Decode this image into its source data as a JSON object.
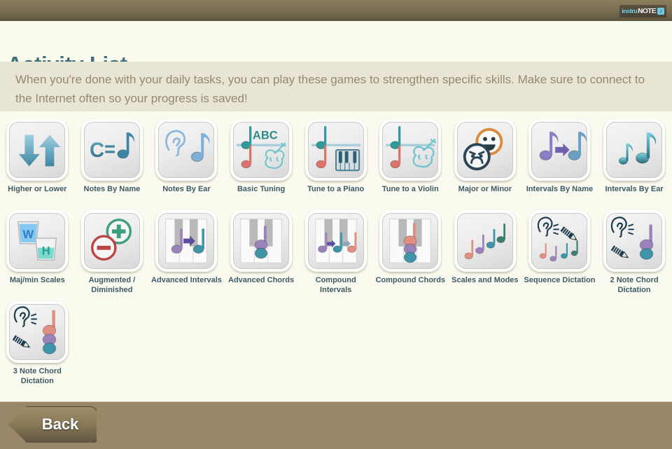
{
  "app": {
    "logo_part1": "instru",
    "logo_part2": "NOTE",
    "logo_badge": "♪"
  },
  "header": {
    "title": "Activity List",
    "description": "When you're done with your daily tasks, you can play these games to strengthen specific skills.  Make sure to connect to the Internet often so your progress is saved!"
  },
  "colors": {
    "topbar": "#7d7053",
    "page_background": "#fbfaee",
    "description_background": "#e8e5d5",
    "title_text": "#3f7078",
    "description_text": "#938a6e",
    "label_text": "#3d5a67",
    "bottombar": "#998767",
    "back_button": "#8a7a58"
  },
  "activities": [
    {
      "label": "Higher or Lower",
      "icon": "up-down-arrows-icon"
    },
    {
      "label": "Notes By Name",
      "icon": "c-equals-note-icon"
    },
    {
      "label": "Notes By Ear",
      "icon": "ear-note-icon"
    },
    {
      "label": "Basic Tuning",
      "icon": "abc-violin-staff-icon"
    },
    {
      "label": "Tune to a Piano",
      "icon": "piano-staff-icon"
    },
    {
      "label": "Tune to a Violin",
      "icon": "violin-staff-icon"
    },
    {
      "label": "Major or Minor",
      "icon": "happy-sad-faces-icon"
    },
    {
      "label": "Intervals By Name",
      "icon": "note-arrow-note-icon"
    },
    {
      "label": "Intervals By Ear",
      "icon": "two-notes-icon"
    },
    {
      "label": "Maj/min Scales",
      "icon": "whole-half-glasses-icon"
    },
    {
      "label": "Augmented / Diminished",
      "icon": "plus-minus-circles-icon"
    },
    {
      "label": "Advanced Intervals",
      "icon": "piano-note-arrow-note-icon"
    },
    {
      "label": "Advanced Chords",
      "icon": "piano-two-stacked-notes-icon"
    },
    {
      "label": "Compound Intervals",
      "icon": "piano-three-notes-arrows-icon"
    },
    {
      "label": "Compound Chords",
      "icon": "piano-three-stacked-notes-icon"
    },
    {
      "label": "Scales and Modes",
      "icon": "ascending-notes-icon"
    },
    {
      "label": "Sequence Dictation",
      "icon": "ear-pencil-notes-icon"
    },
    {
      "label": "2 Note Chord Dictation",
      "icon": "ear-pencil-two-stacked-notes-icon"
    },
    {
      "label": "3 Note Chord Dictation",
      "icon": "ear-pencil-three-stacked-notes-icon"
    }
  ],
  "footer": {
    "back_label": "Back"
  }
}
